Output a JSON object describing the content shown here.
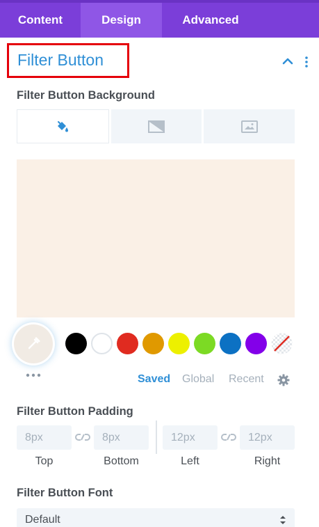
{
  "tabs": {
    "content": "Content",
    "design": "Design",
    "advanced": "Advanced",
    "active": "Design"
  },
  "section": {
    "title": "Filter Button"
  },
  "background": {
    "label": "Filter Button Background",
    "tabs": [
      {
        "name": "color",
        "icon": "paint-bucket-icon",
        "active": true
      },
      {
        "name": "gradient",
        "icon": "gradient-icon",
        "active": false
      },
      {
        "name": "image",
        "icon": "image-icon",
        "active": false
      }
    ],
    "current_color": "#faf0e6"
  },
  "swatches": [
    "#000000",
    "#ffffff",
    "#e02b20",
    "#e09900",
    "#edf000",
    "#7cda24",
    "#0c71c3",
    "#8300e9",
    "none"
  ],
  "palette_tabs": {
    "saved": "Saved",
    "global": "Global",
    "recent": "Recent",
    "active": "Saved"
  },
  "padding": {
    "label": "Filter Button Padding",
    "top": {
      "placeholder": "8px",
      "caption": "Top"
    },
    "bottom": {
      "placeholder": "8px",
      "caption": "Bottom"
    },
    "left": {
      "placeholder": "12px",
      "caption": "Left"
    },
    "right": {
      "placeholder": "12px",
      "caption": "Right"
    }
  },
  "font": {
    "label": "Filter Button Font",
    "value": "Default"
  },
  "colors": {
    "accent": "#2f8fd6",
    "tab_bar": "#7b3ed9",
    "highlight_box": "#e5000a"
  }
}
